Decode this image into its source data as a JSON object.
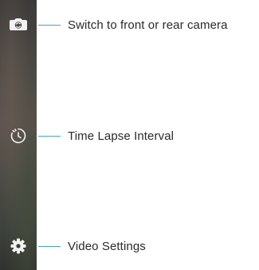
{
  "camera_controls": [
    {
      "label": "Switch to front or rear camera",
      "icon": "camera-switch-icon"
    },
    {
      "label": "Time Lapse Interval",
      "icon": "timelapse-icon"
    },
    {
      "label": "Video Settings",
      "icon": "gear-icon"
    }
  ],
  "colors": {
    "leader_line": "#4aa3c8",
    "label_text": "#2a2a2a",
    "icon": "#ffffff"
  }
}
